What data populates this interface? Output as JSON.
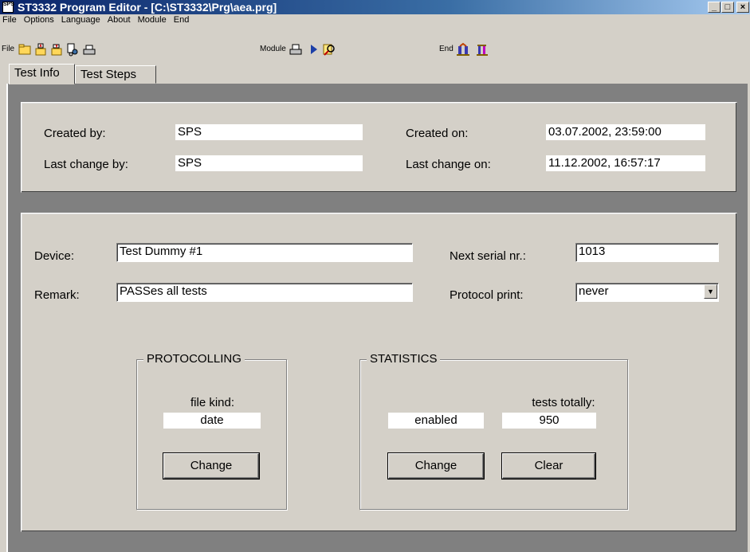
{
  "window": {
    "title": "ST3332  Program Editor - [C:\\ST3332\\Prg\\aea.prg]",
    "app_icon_text": "SPS",
    "minimize": "_",
    "maximize": "□",
    "close": "×"
  },
  "menu": {
    "items": [
      "File",
      "Options",
      "Language",
      "About",
      "Module",
      "End"
    ]
  },
  "toolbar": {
    "file_label": "File",
    "module_label": "Module",
    "end_label": "End",
    "icons": [
      "new-file-icon",
      "open-file-icon",
      "save-file-icon",
      "settings-file-icon",
      "print-icon",
      "module-print-icon",
      "run-icon",
      "search-icon",
      "exit-door-icon",
      "exit-door-small-icon"
    ]
  },
  "tabs": [
    {
      "label": "Test Info",
      "active": true
    },
    {
      "label": "Test Steps",
      "active": false
    }
  ],
  "info": {
    "created_by_label": "Created by:",
    "created_by": "SPS",
    "last_change_by_label": "Last change by:",
    "last_change_by": "SPS",
    "created_on_label": "Created on:",
    "created_on": "03.07.2002, 23:59:00",
    "last_change_on_label": "Last change on:",
    "last_change_on": "11.12.2002, 16:57:17"
  },
  "form": {
    "device_label": "Device:",
    "device": "Test Dummy #1",
    "remark_label": "Remark:",
    "remark": "PASSes all tests",
    "next_serial_label": "Next serial nr.:",
    "next_serial": "1013",
    "protocol_print_label": "Protocol print:",
    "protocol_print": "never"
  },
  "protocolling": {
    "title": "PROTOCOLLING",
    "file_kind_label": "file kind:",
    "file_kind": "date",
    "change_label": "Change"
  },
  "statistics": {
    "title": "STATISTICS",
    "tests_totally_label": "tests totally:",
    "state": "enabled",
    "tests_totally": "950",
    "change_label": "Change",
    "clear_label": "Clear"
  },
  "colors": {
    "title_bar_start": "#0a246a",
    "title_bar_end": "#a6caf0",
    "window_bg": "#d4d0c8",
    "workspace_bg": "#808080"
  }
}
